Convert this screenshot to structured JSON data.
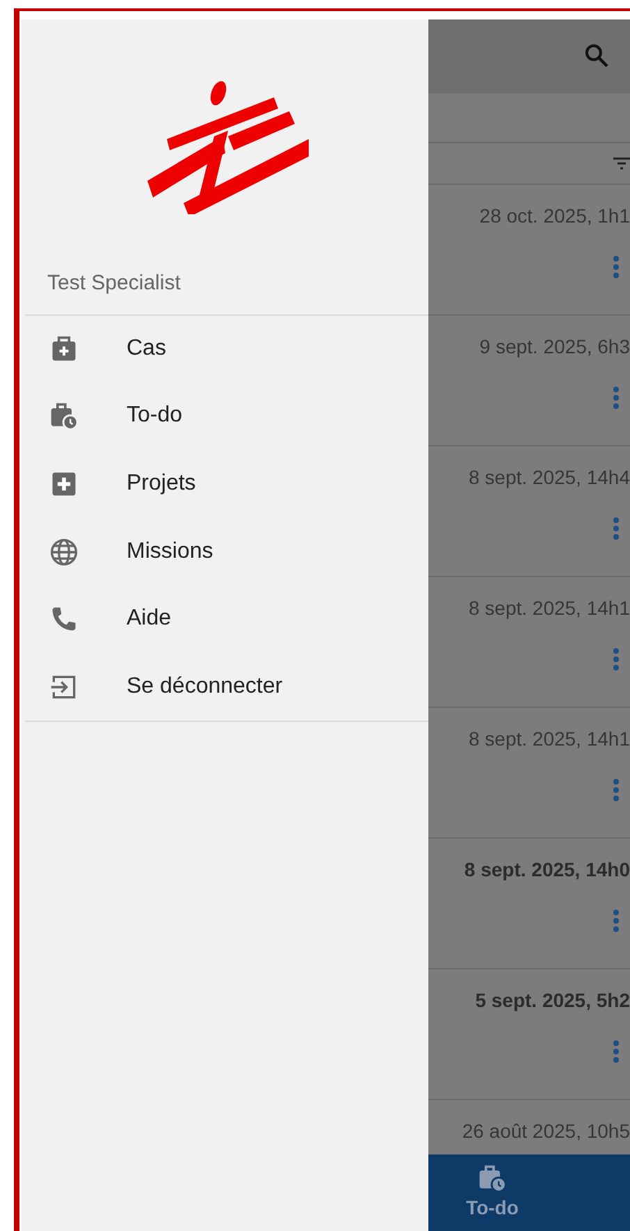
{
  "drawer": {
    "user_name": "Test Specialist",
    "items": [
      {
        "label": "Cas"
      },
      {
        "label": "To-do"
      },
      {
        "label": "Projets"
      },
      {
        "label": "Missions"
      },
      {
        "label": "Aide"
      },
      {
        "label": "Se déconnecter"
      }
    ]
  },
  "list": {
    "rows": [
      {
        "date": "28 oct. 2025, 1h1",
        "unread": false
      },
      {
        "date": "9 sept. 2025, 6h3",
        "unread": false
      },
      {
        "date": "8 sept. 2025, 14h4",
        "unread": false
      },
      {
        "date": "8 sept. 2025, 14h1",
        "unread": false
      },
      {
        "date": "8 sept. 2025, 14h1",
        "unread": false
      },
      {
        "date": "8 sept. 2025, 14h0",
        "unread": true
      },
      {
        "date": "5 sept. 2025, 5h2",
        "unread": true
      },
      {
        "date": "26 août 2025, 10h5",
        "unread": false
      }
    ]
  },
  "bottom_nav": {
    "items": [
      {
        "label": "To-do",
        "selected": true
      }
    ]
  }
}
